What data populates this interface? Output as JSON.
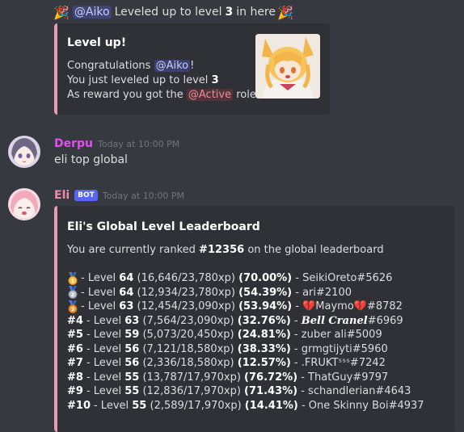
{
  "levelup": {
    "party_left": "🎉",
    "mention": "@Aiko",
    "text_before": "Leveled up to level",
    "level": "3",
    "text_after": "in here",
    "party_right": "🎉"
  },
  "levelup_embed": {
    "title": "Level up!",
    "line1_prefix": "Congratulations",
    "line1_mention": "@Aiko",
    "line1_suffix": "!",
    "line2_prefix": "You just leveled up to level",
    "line2_level": "3",
    "line3_prefix": "As reward you got the",
    "line3_role": "@Active",
    "line3_suffix": "role!",
    "accent_color": "#e89cb3"
  },
  "messages": [
    {
      "username": "Derpu",
      "username_color": "#e24ff0",
      "timestamp": "Today at 10:00 PM",
      "content": "eli top global"
    },
    {
      "username": "Eli",
      "username_color": "#ef8aa6",
      "badge": "BOT",
      "timestamp": "Today at 10:00 PM"
    }
  ],
  "leaderboard_embed": {
    "title": "Eli's Global Level Leaderboard",
    "desc_prefix": "You are currently ranked",
    "desc_rank": "#12356",
    "desc_suffix": "on the global leaderboard",
    "rows": [
      {
        "rank": "",
        "medal": "gold",
        "level": "64",
        "xp": "(16,646/23,780xp)",
        "pct": "(70.00%)",
        "user": "SeikiOreto#5626"
      },
      {
        "rank": "",
        "medal": "silver",
        "level": "64",
        "xp": "(12,934/23,780xp)",
        "pct": "(54.39%)",
        "user": "ari#2100"
      },
      {
        "rank": "",
        "medal": "bronze",
        "level": "63",
        "xp": "(12,454/23,090xp)",
        "pct": "(53.94%)",
        "user_pre": "💔",
        "user": "Maymo",
        "user_post": "💔",
        "user_tag": "#8782"
      },
      {
        "rank": "#4",
        "level": "63",
        "xp": "(7,564/23,090xp)",
        "pct": "(32.76%)",
        "user_fancy": "Bell Cranel",
        "user": "#6969"
      },
      {
        "rank": "#5",
        "level": "59",
        "xp": "(5,073/20,450xp)",
        "pct": "(24.81%)",
        "user": "zuber ali#5009"
      },
      {
        "rank": "#6",
        "level": "56",
        "xp": "(7,121/18,580xp)",
        "pct": "(38.33%)",
        "user": "grmgtijyti#5960"
      },
      {
        "rank": "#7",
        "level": "56",
        "xp": "(2,336/18,580xp)",
        "pct": "(12.57%)",
        "user": ".FRUKTˢˢˢ#7242"
      },
      {
        "rank": "#8",
        "level": "55",
        "xp": "(13,787/17,970xp)",
        "pct": "(76.72%)",
        "user": "ThatGuy#9797"
      },
      {
        "rank": "#9",
        "level": "55",
        "xp": "(12,836/17,970xp)",
        "pct": "(71.43%)",
        "user": "schandlerian#4643"
      },
      {
        "rank": "#10",
        "level": "55",
        "xp": "(2,589/17,970xp)",
        "pct": "(14.41%)",
        "user": "One Skinny Boi#4937"
      }
    ],
    "level_label": "Level",
    "dash": "-"
  }
}
